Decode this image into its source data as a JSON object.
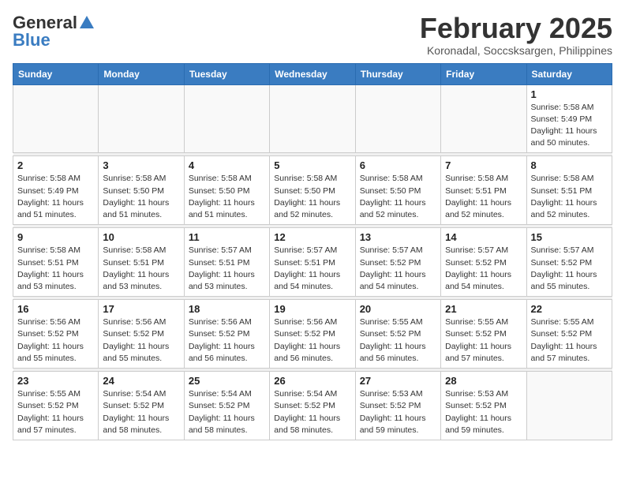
{
  "header": {
    "logo_general": "General",
    "logo_blue": "Blue",
    "month_year": "February 2025",
    "location": "Koronadal, Soccsksargen, Philippines"
  },
  "days_of_week": [
    "Sunday",
    "Monday",
    "Tuesday",
    "Wednesday",
    "Thursday",
    "Friday",
    "Saturday"
  ],
  "weeks": [
    {
      "days": [
        {
          "num": "",
          "info": ""
        },
        {
          "num": "",
          "info": ""
        },
        {
          "num": "",
          "info": ""
        },
        {
          "num": "",
          "info": ""
        },
        {
          "num": "",
          "info": ""
        },
        {
          "num": "",
          "info": ""
        },
        {
          "num": "1",
          "info": "Sunrise: 5:58 AM\nSunset: 5:49 PM\nDaylight: 11 hours\nand 50 minutes."
        }
      ]
    },
    {
      "days": [
        {
          "num": "2",
          "info": "Sunrise: 5:58 AM\nSunset: 5:49 PM\nDaylight: 11 hours\nand 51 minutes."
        },
        {
          "num": "3",
          "info": "Sunrise: 5:58 AM\nSunset: 5:50 PM\nDaylight: 11 hours\nand 51 minutes."
        },
        {
          "num": "4",
          "info": "Sunrise: 5:58 AM\nSunset: 5:50 PM\nDaylight: 11 hours\nand 51 minutes."
        },
        {
          "num": "5",
          "info": "Sunrise: 5:58 AM\nSunset: 5:50 PM\nDaylight: 11 hours\nand 52 minutes."
        },
        {
          "num": "6",
          "info": "Sunrise: 5:58 AM\nSunset: 5:50 PM\nDaylight: 11 hours\nand 52 minutes."
        },
        {
          "num": "7",
          "info": "Sunrise: 5:58 AM\nSunset: 5:51 PM\nDaylight: 11 hours\nand 52 minutes."
        },
        {
          "num": "8",
          "info": "Sunrise: 5:58 AM\nSunset: 5:51 PM\nDaylight: 11 hours\nand 52 minutes."
        }
      ]
    },
    {
      "days": [
        {
          "num": "9",
          "info": "Sunrise: 5:58 AM\nSunset: 5:51 PM\nDaylight: 11 hours\nand 53 minutes."
        },
        {
          "num": "10",
          "info": "Sunrise: 5:58 AM\nSunset: 5:51 PM\nDaylight: 11 hours\nand 53 minutes."
        },
        {
          "num": "11",
          "info": "Sunrise: 5:57 AM\nSunset: 5:51 PM\nDaylight: 11 hours\nand 53 minutes."
        },
        {
          "num": "12",
          "info": "Sunrise: 5:57 AM\nSunset: 5:51 PM\nDaylight: 11 hours\nand 54 minutes."
        },
        {
          "num": "13",
          "info": "Sunrise: 5:57 AM\nSunset: 5:52 PM\nDaylight: 11 hours\nand 54 minutes."
        },
        {
          "num": "14",
          "info": "Sunrise: 5:57 AM\nSunset: 5:52 PM\nDaylight: 11 hours\nand 54 minutes."
        },
        {
          "num": "15",
          "info": "Sunrise: 5:57 AM\nSunset: 5:52 PM\nDaylight: 11 hours\nand 55 minutes."
        }
      ]
    },
    {
      "days": [
        {
          "num": "16",
          "info": "Sunrise: 5:56 AM\nSunset: 5:52 PM\nDaylight: 11 hours\nand 55 minutes."
        },
        {
          "num": "17",
          "info": "Sunrise: 5:56 AM\nSunset: 5:52 PM\nDaylight: 11 hours\nand 55 minutes."
        },
        {
          "num": "18",
          "info": "Sunrise: 5:56 AM\nSunset: 5:52 PM\nDaylight: 11 hours\nand 56 minutes."
        },
        {
          "num": "19",
          "info": "Sunrise: 5:56 AM\nSunset: 5:52 PM\nDaylight: 11 hours\nand 56 minutes."
        },
        {
          "num": "20",
          "info": "Sunrise: 5:55 AM\nSunset: 5:52 PM\nDaylight: 11 hours\nand 56 minutes."
        },
        {
          "num": "21",
          "info": "Sunrise: 5:55 AM\nSunset: 5:52 PM\nDaylight: 11 hours\nand 57 minutes."
        },
        {
          "num": "22",
          "info": "Sunrise: 5:55 AM\nSunset: 5:52 PM\nDaylight: 11 hours\nand 57 minutes."
        }
      ]
    },
    {
      "days": [
        {
          "num": "23",
          "info": "Sunrise: 5:55 AM\nSunset: 5:52 PM\nDaylight: 11 hours\nand 57 minutes."
        },
        {
          "num": "24",
          "info": "Sunrise: 5:54 AM\nSunset: 5:52 PM\nDaylight: 11 hours\nand 58 minutes."
        },
        {
          "num": "25",
          "info": "Sunrise: 5:54 AM\nSunset: 5:52 PM\nDaylight: 11 hours\nand 58 minutes."
        },
        {
          "num": "26",
          "info": "Sunrise: 5:54 AM\nSunset: 5:52 PM\nDaylight: 11 hours\nand 58 minutes."
        },
        {
          "num": "27",
          "info": "Sunrise: 5:53 AM\nSunset: 5:52 PM\nDaylight: 11 hours\nand 59 minutes."
        },
        {
          "num": "28",
          "info": "Sunrise: 5:53 AM\nSunset: 5:52 PM\nDaylight: 11 hours\nand 59 minutes."
        },
        {
          "num": "",
          "info": ""
        }
      ]
    }
  ]
}
